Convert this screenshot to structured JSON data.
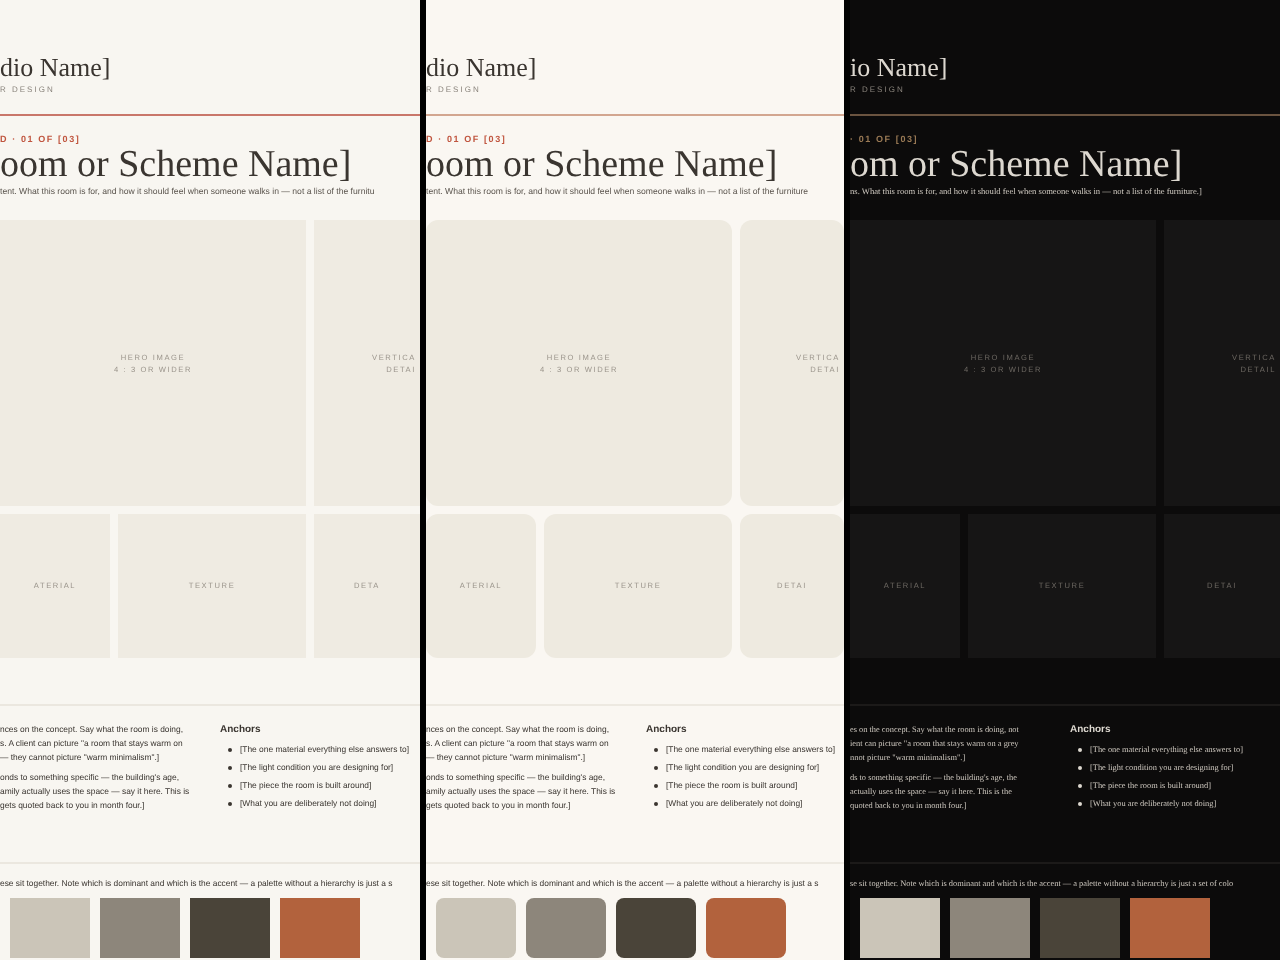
{
  "panels": [
    {
      "kind": "light",
      "studio": "dio Name]",
      "tagline": "R DESIGN",
      "eyebrow": "D · 01 OF [03]",
      "title": "oom or Scheme Name]",
      "intro": "tent. What this room is for, and how it should feel when someone walks in — not a list of the furnitu",
      "tiles": [
        {
          "lines": [
            "HERO IMAGE",
            "4 : 3 OR WIDER"
          ]
        },
        {
          "lines": [
            "VERTICA",
            "DETAI"
          ]
        },
        {
          "lines": [
            "ATERIAL"
          ]
        },
        {
          "lines": [
            "TEXTURE"
          ]
        },
        {
          "lines": [
            "DETA"
          ]
        }
      ],
      "concept": [
        [
          "nces on the concept. Say what the room is doing,",
          "s. A client can picture \"a room that stays warm on",
          "— they cannot picture \"warm minimalism\".]"
        ],
        [
          "onds to something specific — the building's age,",
          "amily actually uses the space — say it here. This is",
          "gets quoted back to you in month four.]"
        ]
      ],
      "anchors_title": "Anchors",
      "anchors": [
        "[The one material everything else answers to]",
        "[The light condition you are designing for]",
        "[The piece the room is built around]",
        "[What you are deliberately not doing]"
      ],
      "palette_note": "ese sit together. Note which is dominant and which is the accent — a palette without a hierarchy is just a s",
      "swatches": [
        {
          "color": "#cbc5b8"
        },
        {
          "color": "#8d867b"
        },
        {
          "color": "#4a4439"
        },
        {
          "color": "#b2623d"
        }
      ]
    },
    {
      "kind": "soft",
      "studio": "dio Name]",
      "tagline": "R DESIGN",
      "eyebrow": "D · 01 OF [03]",
      "title": "oom or Scheme Name]",
      "intro": "tent. What this room is for, and how it should feel when someone walks in — not a list of the furniture",
      "tiles": [
        {
          "lines": [
            "HERO IMAGE",
            "4 : 3 OR WIDER"
          ]
        },
        {
          "lines": [
            "VERTICA",
            "DETAI"
          ]
        },
        {
          "lines": [
            "ATERIAL"
          ]
        },
        {
          "lines": [
            "TEXTURE"
          ]
        },
        {
          "lines": [
            "DETAI"
          ]
        }
      ],
      "concept": [
        [
          "nces on the concept. Say what the room is doing,",
          "s. A client can picture \"a room that stays warm on",
          "— they cannot picture \"warm minimalism\".]"
        ],
        [
          "onds to something specific — the building's age,",
          "amily actually uses the space — say it here. This is",
          "gets quoted back to you in month four.]"
        ]
      ],
      "anchors_title": "Anchors",
      "anchors": [
        "[The one material everything else answers to]",
        "[The light condition you are designing for]",
        "[The piece the room is built around]",
        "[What you are deliberately not doing]"
      ],
      "palette_note": "ese sit together. Note which is dominant and which is the accent — a palette without a hierarchy is just a s",
      "swatches": [
        {
          "color": "#cbc5b8"
        },
        {
          "color": "#8d867b"
        },
        {
          "color": "#4a4439"
        },
        {
          "color": "#b2623d"
        }
      ]
    },
    {
      "kind": "dark",
      "studio": "io Name]",
      "tagline": "R DESIGN",
      "eyebrow": "· 01 OF [03]",
      "title": "om or Scheme Name]",
      "intro": "ns. What this room is for, and how it should feel when someone walks in — not a list of the furniture.]",
      "tiles": [
        {
          "lines": [
            "HERO IMAGE",
            "4 : 3 OR WIDER"
          ]
        },
        {
          "lines": [
            "VERTICA",
            "DETAIL"
          ]
        },
        {
          "lines": [
            "ATERIAL"
          ]
        },
        {
          "lines": [
            "TEXTURE"
          ]
        },
        {
          "lines": [
            "DETAI"
          ]
        }
      ],
      "concept": [
        [
          "es on the concept. Say what the room is doing, not",
          "ient can picture \"a room that stays warm on a grey",
          "nnot picture \"warm minimalism\".]"
        ],
        [
          "ds to something specific — the building's age, the",
          "actually uses the space — say it here. This is the",
          "quoted back to you in month four.]"
        ]
      ],
      "anchors_title": "Anchors",
      "anchors": [
        "[The one material everything else answers to]",
        "[The light condition you are designing for]",
        "[The piece the room is built around]",
        "[What you are deliberately not doing]"
      ],
      "palette_note": "se sit together. Note which is dominant and which is the accent — a palette without a hierarchy is just a set of colo",
      "swatches": [
        {
          "color": "#cbc5b8"
        },
        {
          "color": "#8d867b"
        },
        {
          "color": "#4a4439"
        },
        {
          "color": "#b2623d"
        }
      ]
    }
  ]
}
